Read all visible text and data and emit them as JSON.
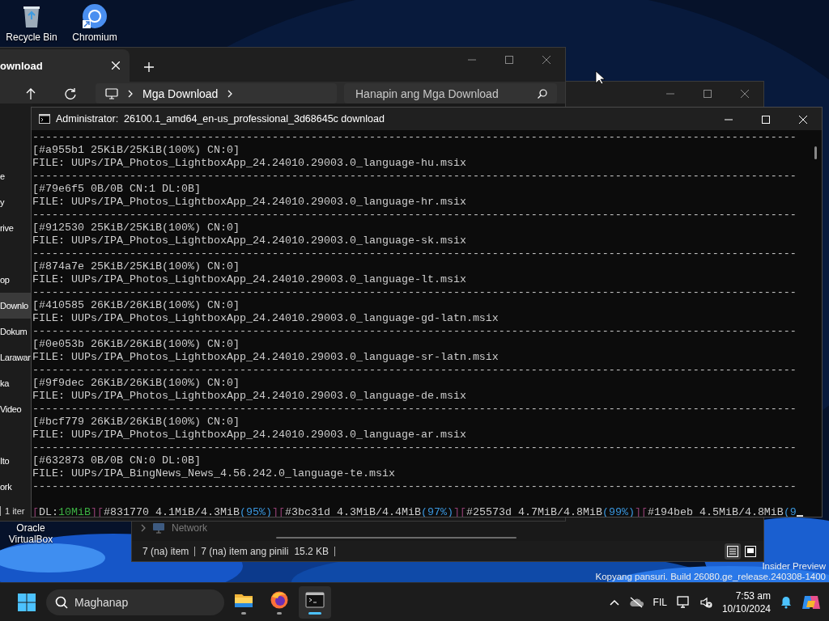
{
  "desktop_icons": [
    {
      "label": "Recycle Bin",
      "kind": "recycle"
    },
    {
      "label": "Chromium",
      "kind": "chromium"
    },
    {
      "label": "Oracle VirtualBox",
      "kind": "covered"
    }
  ],
  "explorer_back": {
    "tab": {
      "label": "ownload"
    },
    "breadcrumb": [
      "Mga Download"
    ],
    "search": {
      "placeholder": "Hanapin ang Mga Download"
    },
    "sidebar_sections": [
      [
        {
          "label": "e",
          "selected": false
        },
        {
          "label": "y",
          "selected": false
        },
        {
          "label": "rive",
          "selected": false
        }
      ],
      [
        {
          "label": "op",
          "selected": false
        },
        {
          "label": "Downlo",
          "selected": true
        },
        {
          "label": "Dokum",
          "selected": false
        },
        {
          "label": "Larawar",
          "selected": false
        },
        {
          "label": "ka",
          "selected": false
        },
        {
          "label": "Video",
          "selected": false
        }
      ],
      [
        {
          "label": "Ito",
          "selected": false
        },
        {
          "label": "ork",
          "selected": false
        }
      ]
    ],
    "status": "1 iter"
  },
  "explorer_front": {
    "nav_item": {
      "label": "Network"
    },
    "status": {
      "items": "7 (na) item",
      "selection": "7 (na) item ang pinili",
      "size": "15.2 KB"
    },
    "view_buttons": [
      {
        "kind": "details",
        "selected": true
      },
      {
        "kind": "tiles",
        "selected": false
      }
    ]
  },
  "console": {
    "title": "Administrator:  26100.1_amd64_en-us_professional_3d68645c download",
    "lines": [
      "----------------------------------------------------------------------------------------------------------------------",
      "[#a955b1 25KiB/25KiB(100%) CN:0]",
      "FILE: UUPs/IPA_Photos_LightboxApp_24.24010.29003.0_language-hu.msix",
      "----------------------------------------------------------------------------------------------------------------------",
      "[#79e6f5 0B/0B CN:1 DL:0B]",
      "FILE: UUPs/IPA_Photos_LightboxApp_24.24010.29003.0_language-hr.msix",
      "----------------------------------------------------------------------------------------------------------------------",
      "[#912530 25KiB/25KiB(100%) CN:0]",
      "FILE: UUPs/IPA_Photos_LightboxApp_24.24010.29003.0_language-sk.msix",
      "----------------------------------------------------------------------------------------------------------------------",
      "[#874a7e 25KiB/25KiB(100%) CN:0]",
      "FILE: UUPs/IPA_Photos_LightboxApp_24.24010.29003.0_language-lt.msix",
      "----------------------------------------------------------------------------------------------------------------------",
      "[#410585 26KiB/26KiB(100%) CN:0]",
      "FILE: UUPs/IPA_Photos_LightboxApp_24.24010.29003.0_language-gd-latn.msix",
      "----------------------------------------------------------------------------------------------------------------------",
      "[#0e053b 26KiB/26KiB(100%) CN:0]",
      "FILE: UUPs/IPA_Photos_LightboxApp_24.24010.29003.0_language-sr-latn.msix",
      "----------------------------------------------------------------------------------------------------------------------",
      "[#9f9dec 26KiB/26KiB(100%) CN:0]",
      "FILE: UUPs/IPA_Photos_LightboxApp_24.24010.29003.0_language-de.msix",
      "----------------------------------------------------------------------------------------------------------------------",
      "[#bcf779 26KiB/26KiB(100%) CN:0]",
      "FILE: UUPs/IPA_Photos_LightboxApp_24.24010.29003.0_language-ar.msix",
      "----------------------------------------------------------------------------------------------------------------------",
      "[#632873 0B/0B CN:0 DL:0B]",
      "FILE: UUPs/IPA_BingNews_News_4.56.242.0_language-te.msix",
      "----------------------------------------------------------------------------------------------------------------------"
    ],
    "progress_line": [
      {
        "text": "[",
        "color": "#8f3f71"
      },
      {
        "text": "DL:",
        "color": "#cccccc"
      },
      {
        "text": "10MiB",
        "color": "#3cb043"
      },
      {
        "text": "]",
        "color": "#8f3f71"
      },
      {
        "text": "[",
        "color": "#8f3f71"
      },
      {
        "text": "#831770 4.1MiB/4.3MiB",
        "color": "#cccccc"
      },
      {
        "text": "(95%)",
        "color": "#3a96dd"
      },
      {
        "text": "]",
        "color": "#8f3f71"
      },
      {
        "text": "[",
        "color": "#8f3f71"
      },
      {
        "text": "#3bc31d 4.3MiB/4.4MiB",
        "color": "#cccccc"
      },
      {
        "text": "(97%)",
        "color": "#3a96dd"
      },
      {
        "text": "]",
        "color": "#8f3f71"
      },
      {
        "text": "[",
        "color": "#8f3f71"
      },
      {
        "text": "#25573d 4.7MiB/4.8MiB",
        "color": "#cccccc"
      },
      {
        "text": "(99%)",
        "color": "#3a96dd"
      },
      {
        "text": "]",
        "color": "#8f3f71"
      },
      {
        "text": "[",
        "color": "#8f3f71"
      },
      {
        "text": "#194beb 4.5MiB/4.8MiB",
        "color": "#cccccc"
      },
      {
        "text": "(9",
        "color": "#3a96dd"
      }
    ]
  },
  "build_notice": [
    "Insider Preview",
    "Kopyang pansuri. Build 26080.ge_release.240308-1400"
  ],
  "taskbar": {
    "search": {
      "placeholder": "Maghanap"
    },
    "apps": [
      {
        "kind": "files",
        "active": false
      },
      {
        "kind": "firefox",
        "active": false
      },
      {
        "kind": "terminal",
        "active": true
      }
    ],
    "language": "FIL",
    "time": "7:53 am",
    "date": "10/10/2024"
  }
}
